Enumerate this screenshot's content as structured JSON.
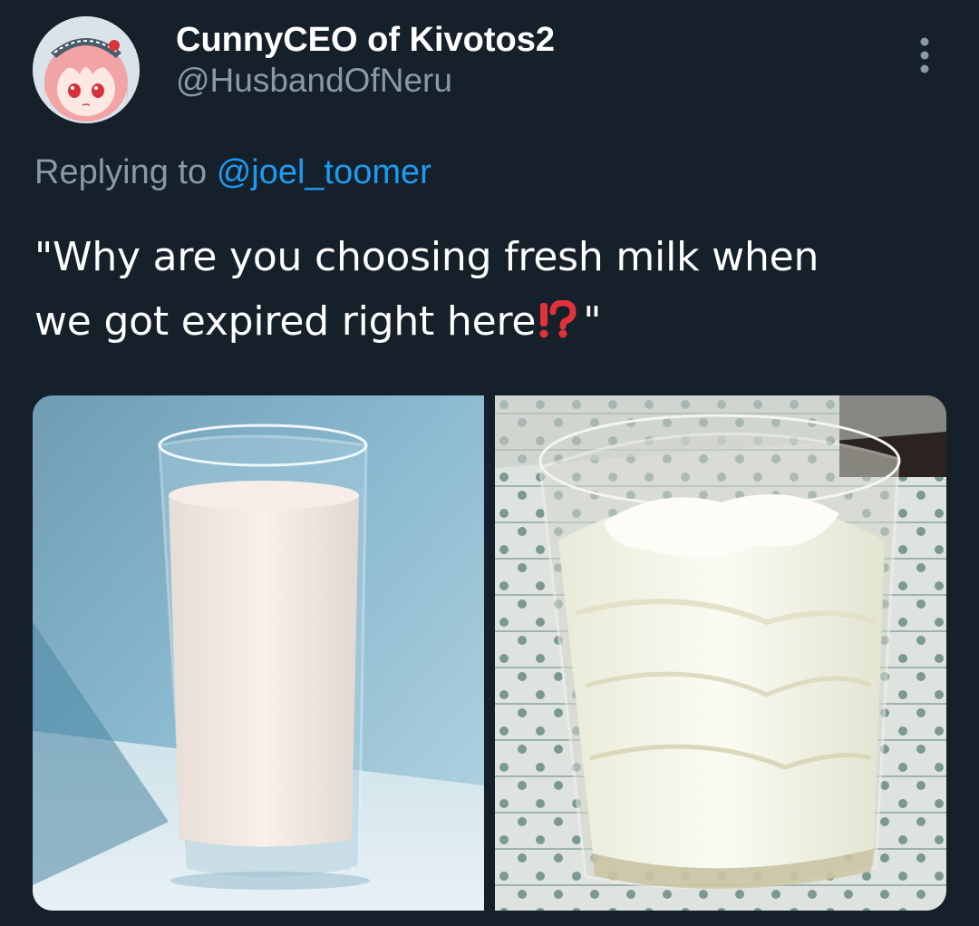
{
  "author": {
    "display_name": "CunnyCEO of Kivotos2",
    "handle": "@HusbandOfNeru",
    "avatar_icon": "anime-avatar-icon"
  },
  "menu": {
    "icon": "more-options-icon"
  },
  "reply": {
    "prefix": "Replying to",
    "mention": "@joel_toomer"
  },
  "tweet": {
    "line1": "\"Why are you choosing fresh milk when",
    "line2_start": "we got expired right here",
    "emoji": "exclamation-question-mark-emoji",
    "line2_end": "\""
  },
  "media": {
    "photos": [
      {
        "name": "fresh-milk-glass-photo"
      },
      {
        "name": "expired-milk-glass-photo"
      }
    ]
  },
  "colors": {
    "background": "#15202b",
    "secondary_text": "#8b98a5",
    "link": "#1d9bf0",
    "emoji_red": "#e0323a"
  }
}
